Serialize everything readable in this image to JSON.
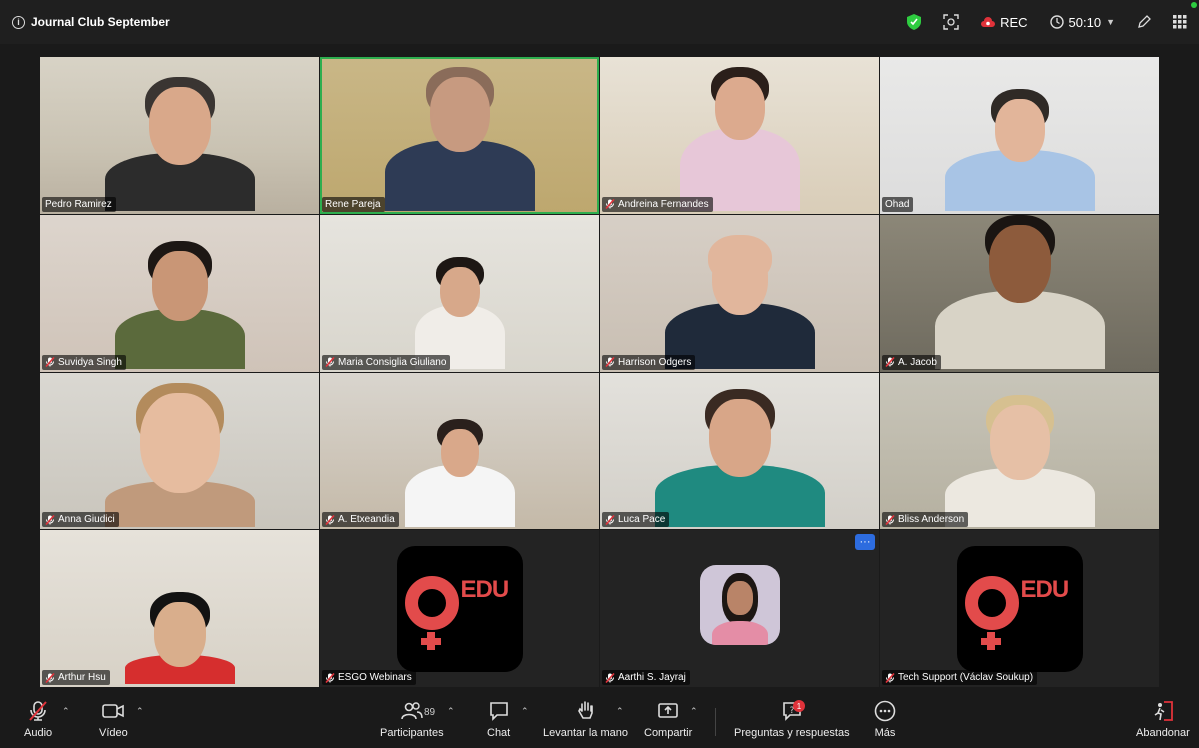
{
  "meeting": {
    "title": "Journal Club September"
  },
  "status": {
    "rec_label": "REC",
    "timer": "50:10"
  },
  "participants": [
    {
      "name": "Pedro Ramirez",
      "muted": false
    },
    {
      "name": "Rene Pareja",
      "muted": false,
      "speaking": true
    },
    {
      "name": "Andreina Fernandes",
      "muted": true
    },
    {
      "name": "Ohad",
      "muted": false
    },
    {
      "name": "Suvidya Singh",
      "muted": true
    },
    {
      "name": "Maria Consiglia Giuliano",
      "muted": true
    },
    {
      "name": "Harrison Odgers",
      "muted": true
    },
    {
      "name": "A. Jacob",
      "muted": true
    },
    {
      "name": "Anna Giudici",
      "muted": true
    },
    {
      "name": "A. Etxeandia",
      "muted": true
    },
    {
      "name": "Luca Pace",
      "muted": true
    },
    {
      "name": "Bliss Anderson",
      "muted": true
    },
    {
      "name": "Arthur Hsu",
      "muted": true
    },
    {
      "name": "ESGO Webinars",
      "muted": true,
      "logo": "EDU"
    },
    {
      "name": "Aarthi S. Jayraj",
      "muted": true
    },
    {
      "name": "Tech Support (Václav Soukup)",
      "muted": true,
      "logo": "EDU"
    }
  ],
  "more_button": "···",
  "toolbar": {
    "audio": "Audio",
    "video": "Vídeo",
    "participants": "Participantes",
    "participants_count": "89",
    "chat": "Chat",
    "raise_hand": "Levantar la mano",
    "share": "Compartir",
    "qa": "Preguntas y respuestas",
    "qa_badge": "1",
    "more": "Más",
    "leave": "Abandonar"
  },
  "colors": {
    "speaking_border": "#2eae4f",
    "accent_red": "#e24b4b",
    "rec_red": "#e0323a",
    "shield_green": "#2ecc40"
  }
}
